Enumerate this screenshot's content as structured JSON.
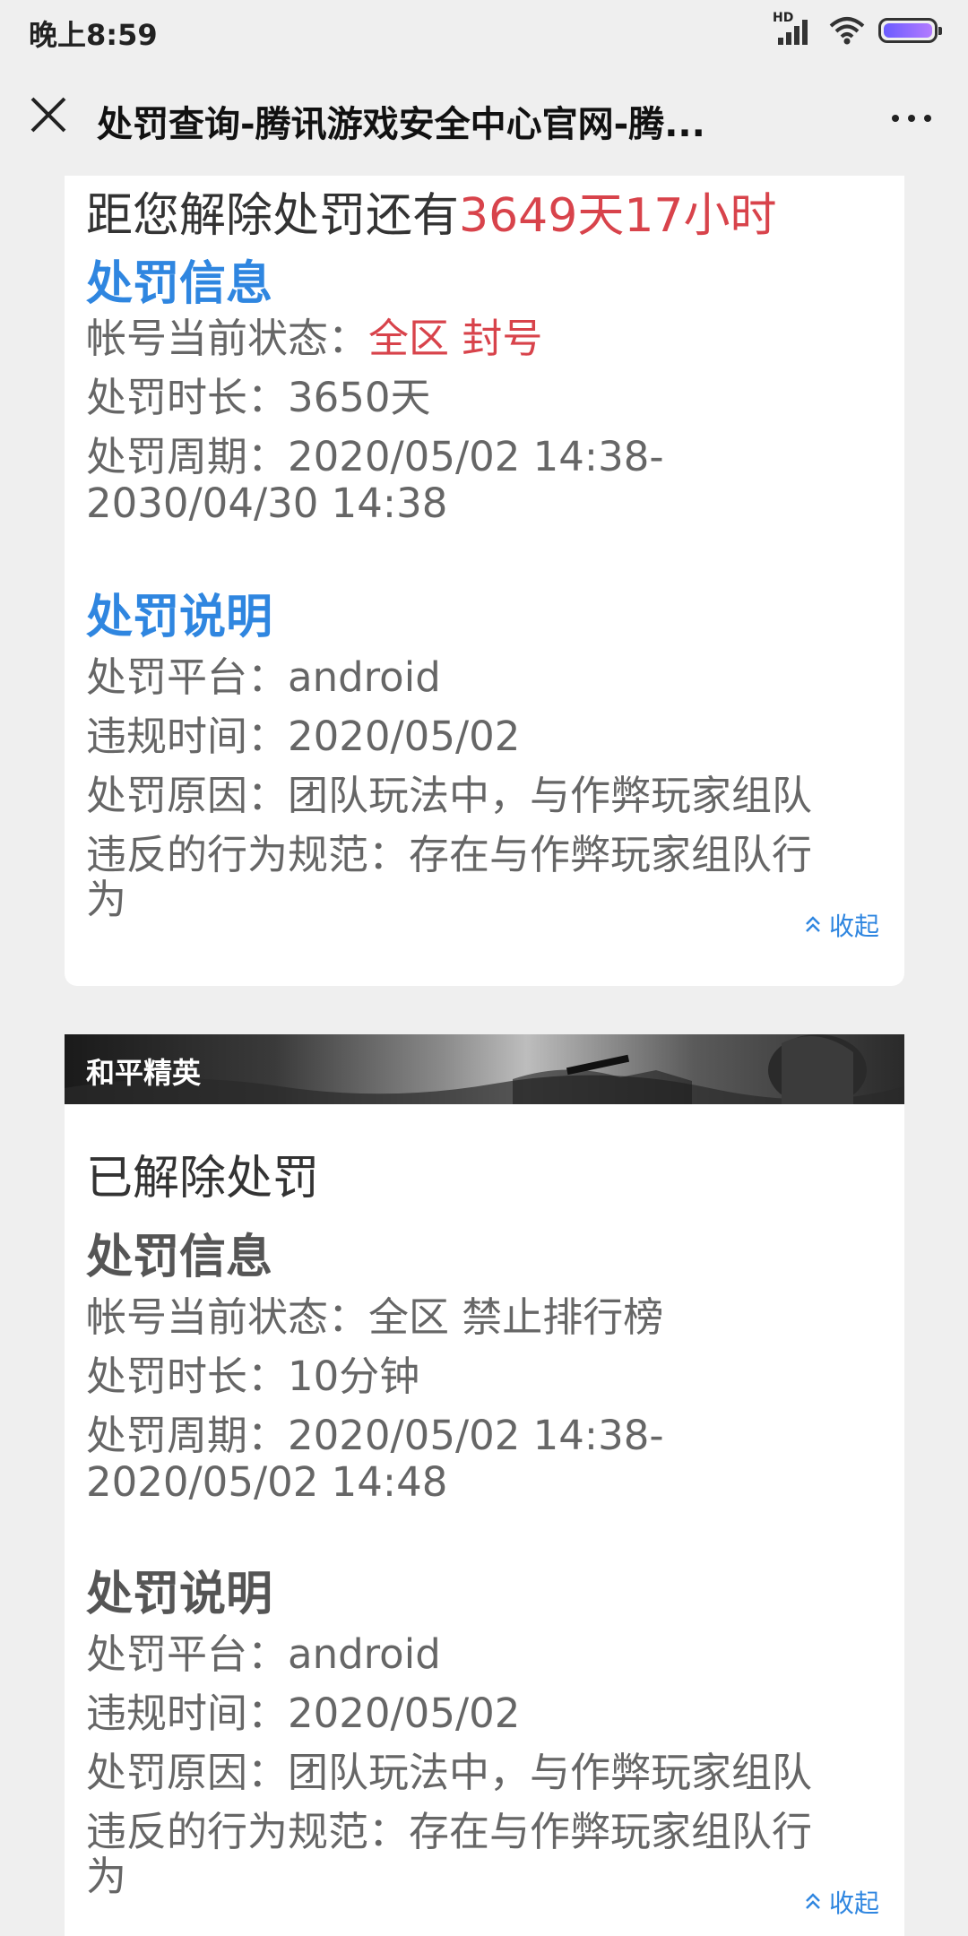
{
  "status_bar": {
    "time": "晚上8:59",
    "network": "HD",
    "icons": [
      "signal-icon",
      "wifi-icon",
      "battery-icon"
    ]
  },
  "nav": {
    "title": "处罚查询-腾讯游戏安全中心官网-腾...",
    "close_icon": "close-icon",
    "more_icon": "more-icon"
  },
  "colors": {
    "accent_blue": "#2f86e0",
    "alert_red": "#d8434b"
  },
  "card1": {
    "remaining_prefix": "距您解除处罚还有",
    "remaining_value": "3649天17小时",
    "info_title": "处罚信息",
    "status_label": "帐号当前状态：",
    "status_value": "全区 封号",
    "duration": "处罚时长：3650天",
    "period_line1": "处罚周期：2020/05/02 14:38-",
    "period_line2": "2030/04/30 14:38",
    "desc_title": "处罚说明",
    "platform": "处罚平台：android",
    "violation_time": "违规时间：2020/05/02",
    "reason": "处罚原因：团队玩法中，与作弊玩家组队",
    "rule_line1": "违反的行为规范：存在与作弊玩家组队行",
    "rule_line2": "为",
    "collapse_label": "收起"
  },
  "card2": {
    "game_name": "和平精英",
    "state": "已解除处罚",
    "info_title": "处罚信息",
    "status": "帐号当前状态：全区 禁止排行榜",
    "duration": "处罚时长：10分钟",
    "period_line1": "处罚周期：2020/05/02 14:38-",
    "period_line2": "2020/05/02 14:48",
    "desc_title": "处罚说明",
    "platform": "处罚平台：android",
    "violation_time": "违规时间：2020/05/02",
    "reason": "处罚原因：团队玩法中，与作弊玩家组队",
    "rule_line1": "违反的行为规范：存在与作弊玩家组队行",
    "rule_line2": "为",
    "collapse_label": "收起"
  }
}
